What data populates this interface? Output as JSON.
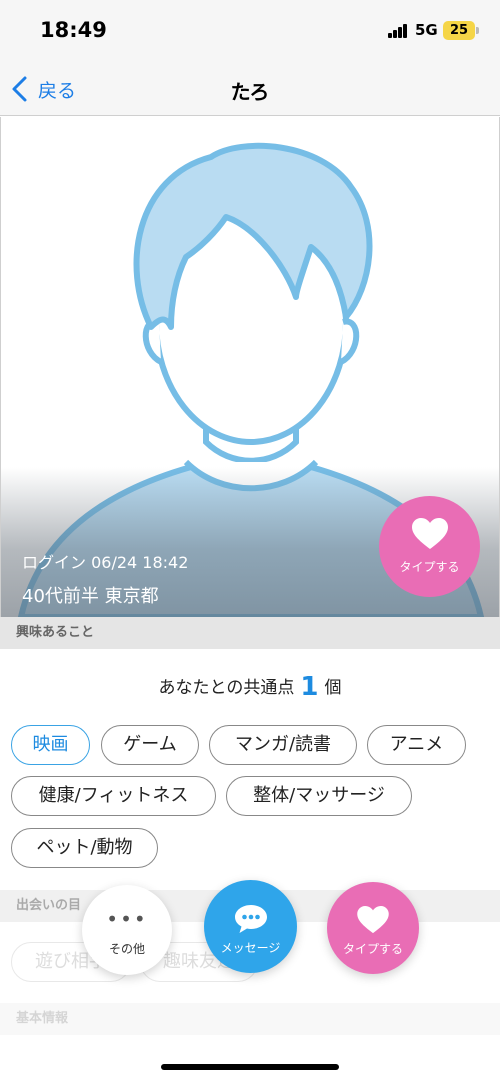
{
  "status_bar": {
    "time": "18:49",
    "network": "5G",
    "battery": "25"
  },
  "nav": {
    "back_label": "戻る",
    "title": "たろ"
  },
  "profile": {
    "login": "ログイン 06/24 18:42",
    "meta": "40代前半  東京都",
    "like_label": "タイプする"
  },
  "interests": {
    "header": "興味あること",
    "common_prefix": "あなたとの共通点",
    "common_count": "1",
    "common_suffix": "個",
    "tags": [
      "映画",
      "ゲーム",
      "マンガ/読書",
      "アニメ",
      "健康/フィットネス",
      "整体/マッサージ",
      "ペット/動物"
    ]
  },
  "purpose": {
    "header": "出会いの目",
    "tags": [
      "遊び相手",
      "趣味友達"
    ]
  },
  "basic": {
    "header": "基本情報"
  },
  "actions": {
    "other_label": "その他",
    "message_label": "メッセージ",
    "like_label": "タイプする"
  },
  "icons": [
    "chevron-left-icon",
    "heart-icon",
    "chat-bubble-icon",
    "more-dots-icon"
  ],
  "colors": {
    "accent_blue": "#1d8be0",
    "like_pink": "#e96db5",
    "message_blue": "#2fa5ea"
  }
}
